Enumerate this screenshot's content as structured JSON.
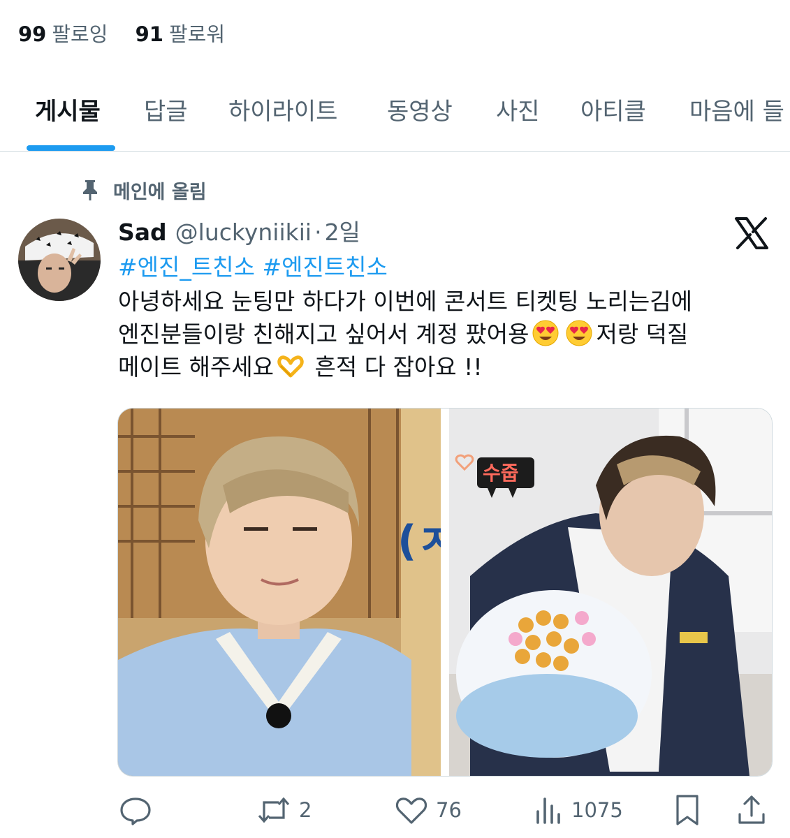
{
  "profile": {
    "following_count": "99",
    "following_label": "팔로잉",
    "followers_count": "91",
    "followers_label": "팔로워"
  },
  "tabs": [
    {
      "label": "게시물",
      "active": true
    },
    {
      "label": "답글"
    },
    {
      "label": "하이라이트"
    },
    {
      "label": "동영상"
    },
    {
      "label": "사진"
    },
    {
      "label": "아티클"
    },
    {
      "label": "마음에 들"
    }
  ],
  "pinned_label": "메인에 올림",
  "post": {
    "display_name": "Sad",
    "handle": "@luckyniikii",
    "separator": "·",
    "time": "2일",
    "hashtags": "#엔진_트친소 #엔진트친소",
    "body": {
      "line1": " 아녕하세요 눈팅만 하다가 이번에 콘서트 티켓팅 노리는김에",
      "line2a": "엔진분들이랑 친해지고 싶어서 계정 팠어용",
      "line2b": "저랑 덕질",
      "line3a": "메이트 해주세요",
      "line3b": " 흔적 다 잡아요 !!"
    },
    "image_caption": "수줍",
    "metrics": {
      "replies": "",
      "reposts": "2",
      "likes": "76",
      "views": "1075"
    }
  },
  "colors": {
    "accent": "#1d9bf0",
    "text_primary": "#0f1419",
    "text_secondary": "#536471",
    "divider": "#cfd9de"
  },
  "icons": [
    "pin-icon",
    "x-logo-icon",
    "heart-eyes-emoji",
    "heart-hands-emoji",
    "reply-icon",
    "repost-icon",
    "like-icon",
    "views-icon",
    "bookmark-icon",
    "share-icon"
  ]
}
